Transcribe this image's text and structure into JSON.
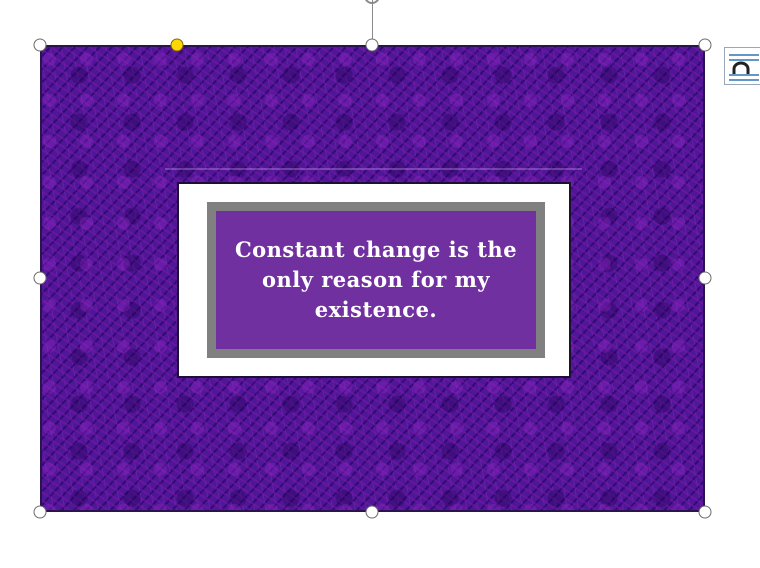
{
  "document": {
    "quote_text": "Constant change is the only reason for my existence."
  },
  "selection": {
    "resize_handles": [
      "top-left",
      "top-center",
      "top-right",
      "middle-left",
      "middle-right",
      "bottom-left",
      "bottom-center",
      "bottom-right"
    ],
    "adjustment_handle": "shape-adjust-handle",
    "rotate_handle": "rotate-icon"
  },
  "toolbar": {
    "layout_options_icon": "layout-options-icon"
  },
  "colors": {
    "frame_purple": "#4f1796",
    "quote_background": "#7030a0",
    "quote_border": "#808080",
    "quote_text": "#ffffff",
    "adjust_handle": "#ffd700"
  }
}
